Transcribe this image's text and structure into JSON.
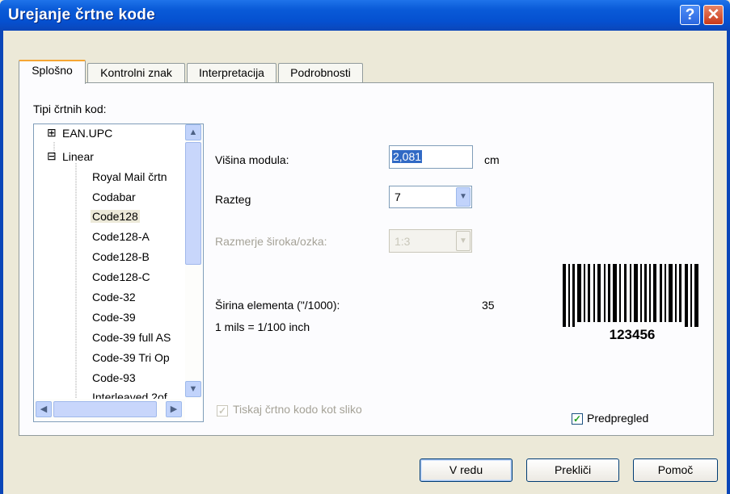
{
  "window": {
    "title": "Urejanje črtne kode"
  },
  "tabs": [
    {
      "label": "Splošno"
    },
    {
      "label": "Kontrolni znak"
    },
    {
      "label": "Interpretacija"
    },
    {
      "label": "Podrobnosti"
    }
  ],
  "tree": {
    "label": "Tipi črtnih kod:",
    "nodes": [
      {
        "label": "EAN.UPC",
        "expander": "+"
      },
      {
        "label": "Linear",
        "expander": "−"
      },
      {
        "label": "Royal Mail črtn"
      },
      {
        "label": "Codabar"
      },
      {
        "label": "Code128",
        "selected": true
      },
      {
        "label": "Code128-A"
      },
      {
        "label": "Code128-B"
      },
      {
        "label": "Code128-C"
      },
      {
        "label": "Code-32"
      },
      {
        "label": "Code-39"
      },
      {
        "label": "Code-39 full AS"
      },
      {
        "label": "Code-39 Tri Op"
      },
      {
        "label": "Code-93"
      },
      {
        "label": "Interleaved 2of"
      }
    ]
  },
  "form": {
    "height_label": "Višina modula:",
    "height_value": "2,081",
    "height_unit": "cm",
    "stretch_label": "Razteg",
    "stretch_value": "7",
    "ratio_label": "Razmerje široka/ozka:",
    "ratio_value": "1:3",
    "width_label": "Širina elementa (\"/1000):",
    "width_value": "35",
    "mils_note": "1 mils = 1/100 inch",
    "print_as_image_label": "Tiskaj črtno kodo kot sliko",
    "print_as_image_checked": true,
    "preview_label": "Predpregled",
    "preview_checked": true
  },
  "preview": {
    "barcode_text": "123456"
  },
  "buttons": {
    "ok": "V redu",
    "cancel": "Prekliči",
    "help": "Pomoč"
  }
}
